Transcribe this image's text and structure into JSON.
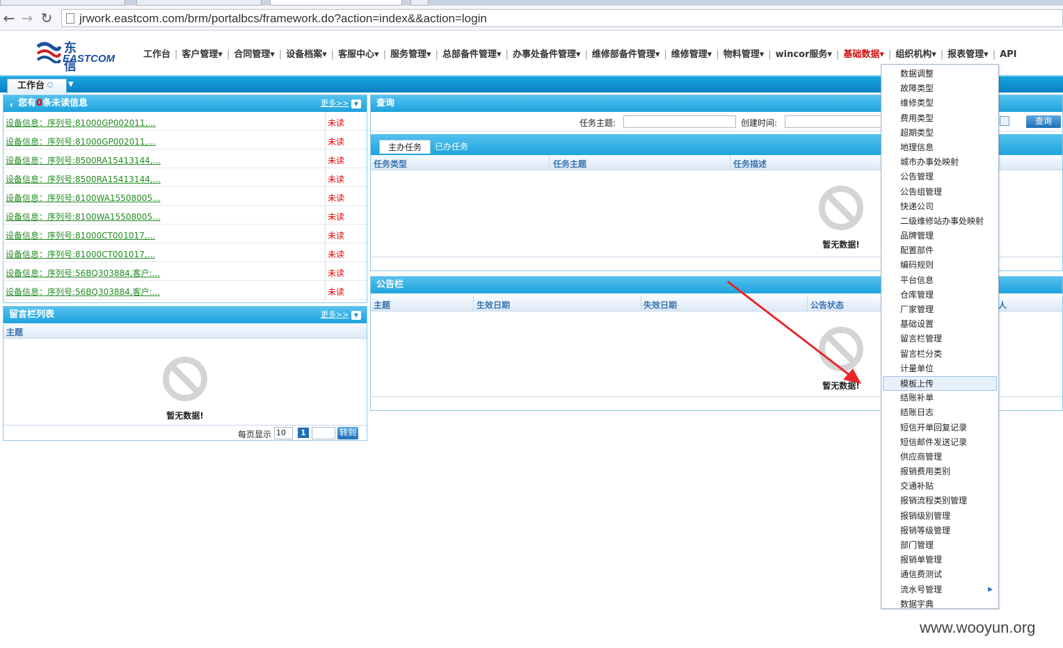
{
  "browser": {
    "url": "jrwork.eastcom.com/brm/portalbcs/framework.do?action=index&&action=login"
  },
  "app": {
    "logo_cn": "东信",
    "logo_en": "EASTCOM",
    "nav": [
      {
        "label": "工作台"
      },
      {
        "label": "客户管理▾"
      },
      {
        "label": "合同管理▾"
      },
      {
        "label": "设备档案▾"
      },
      {
        "label": "客服中心▾"
      },
      {
        "label": "服务管理▾"
      },
      {
        "label": "总部备件管理▾"
      },
      {
        "label": "办事处备件管理▾"
      },
      {
        "label": "维修部备件管理▾"
      },
      {
        "label": "维修管理▾"
      },
      {
        "label": "物料管理▾"
      },
      {
        "label": "wincor服务▾"
      },
      {
        "label": "基础数据▾"
      },
      {
        "label": "组织机构▾"
      },
      {
        "label": "报表管理▾"
      },
      {
        "label": "API"
      }
    ],
    "active_nav_color": "#cc1111"
  },
  "workbar": {
    "tab_label": "工作台"
  },
  "messages": {
    "title_prefix": "，您有",
    "count": "0",
    "title_suffix": "条未读信息",
    "more": "更多>>",
    "rows": [
      {
        "text": "设备信息：序列号:81000GP002011,...",
        "status": "未读"
      },
      {
        "text": "设备信息：序列号:81000GP002011,...",
        "status": "未读"
      },
      {
        "text": "设备信息：序列号:8500RA15413144,...",
        "status": "未读"
      },
      {
        "text": "设备信息：序列号:8500RA15413144,...",
        "status": "未读"
      },
      {
        "text": "设备信息：序列号:8100WA15508005...",
        "status": "未读"
      },
      {
        "text": "设备信息：序列号:8100WA15508005...",
        "status": "未读"
      },
      {
        "text": "设备信息：序列号:81000CT001017,...",
        "status": "未读"
      },
      {
        "text": "设备信息：序列号:81000CT001017,...",
        "status": "未读"
      },
      {
        "text": "设备信息：序列号:56BQ303884,客户:...",
        "status": "未读"
      },
      {
        "text": "设备信息：序列号:56BQ303884,客户:...",
        "status": "未读"
      }
    ]
  },
  "guestbook": {
    "title": "留言栏列表",
    "more": "更多>>",
    "col_subject": "主题",
    "nodata": "暂无数据!",
    "per_page_label": "每页显示",
    "per_page_value": "10",
    "page_num": "1",
    "goto_label": "转到"
  },
  "query": {
    "title": "查询",
    "task_subject_label": "任务主题:",
    "created_time_label": "创建时间:",
    "search_button": "查询",
    "tabs": [
      "主办任务",
      "已办任务"
    ],
    "columns": [
      "任务类型",
      "任务主题",
      "任务描述"
    ],
    "nodata": "暂无数据!"
  },
  "notice": {
    "title": "公告栏",
    "columns": [
      "主题",
      "生效日期",
      "失效日期",
      "公告状态"
    ],
    "col_tail": "人",
    "nodata": "暂无数据!"
  },
  "dropdown": {
    "hover_index": 21,
    "items": [
      "数据调整",
      "故障类型",
      "维修类型",
      "费用类型",
      "超期类型",
      "地理信息",
      "城市办事处映射",
      "公告管理",
      "公告组管理",
      "快递公司",
      "二级维修站办事处映射",
      "品牌管理",
      "配置部件",
      "编码规则",
      "平台信息",
      "仓库管理",
      "厂家管理",
      "基础设置",
      "留言栏管理",
      "留言栏分类",
      "计量单位",
      "模板上传",
      "结账补单",
      "结账日志",
      "短信开单回复记录",
      "短信邮件发送记录",
      "供应商管理",
      "报销费用类别",
      "交通补贴",
      "报销流程类别管理",
      "报销级别管理",
      "报销等级管理",
      "部门管理",
      "报销单管理",
      "通信费测试",
      "流水号管理",
      "数据字典"
    ],
    "submenu_item": "流水号管理"
  },
  "watermark": "www.wooyun.org"
}
